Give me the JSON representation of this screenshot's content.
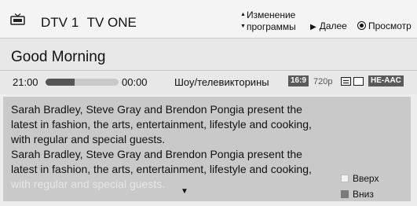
{
  "header": {
    "channel_number": "DTV 1",
    "channel_name": "TV ONE",
    "change_program_line1": "Изменение",
    "change_program_line2": "программы",
    "next_label": "Далее",
    "view_label": "Просмотр"
  },
  "program": {
    "title": "Good Morning",
    "start_time": "21:00",
    "end_time": "00:00",
    "progress": 0.4,
    "genre": "Шоу/телевикторины",
    "aspect_badge": "16:9",
    "resolution": "720p",
    "audio_badge": "HE-AAC"
  },
  "description": {
    "lines": [
      "Sarah Bradley, Steve Gray and Brendon Pongia present the",
      "latest in fashion, the arts, entertainment, lifestyle and cooking,",
      "with regular and special guests.",
      "Sarah Bradley, Steve Gray and Brendon Pongia present the",
      "latest in fashion, the arts, entertainment, lifestyle and cooking,"
    ],
    "faded_line": "with regular and special guests."
  },
  "legend": {
    "up_label": "Вверх",
    "down_label": "Вниз",
    "up_color": "#f2f2f2",
    "down_color": "#7a7a7a"
  },
  "colors": {
    "badge_bg": "#5a5a5a",
    "description_bg": "#c9c9c9",
    "progress_fill": "#555555",
    "progress_track": "#c9c9c9"
  },
  "icons": {
    "tv": "tv-icon",
    "up_down": "up-down-arrows-icon",
    "next": "play-triangle-icon",
    "view": "radio-dot-icon",
    "subtitle": "subtitle-icon",
    "cc": "closed-caption-icon",
    "scroll": "scroll-down-arrow-icon"
  }
}
